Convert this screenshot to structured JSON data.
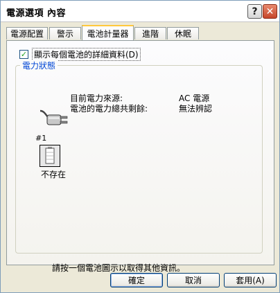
{
  "window": {
    "title": "電源選項 內容",
    "help_label": "?",
    "close_label": "✕"
  },
  "tabs": [
    {
      "label": "電源配置",
      "active": false
    },
    {
      "label": "警示",
      "active": false
    },
    {
      "label": "電池計量器",
      "active": true
    },
    {
      "label": "進階",
      "active": false
    },
    {
      "label": "休眠",
      "active": false
    }
  ],
  "options": {
    "show_details_label": "顯示每個電池的詳細資料(D)",
    "show_details_checked": true
  },
  "power_status": {
    "group_title": "電力狀態",
    "source_label": "目前電力來源:",
    "source_value": "AC 電源",
    "remaining_label": "電池的電力總共剩餘:",
    "remaining_value": "無法辨認"
  },
  "battery": {
    "number": "#1",
    "status": "不存在"
  },
  "hint": "請按一個電池圖示以取得其他資訊。",
  "buttons": {
    "ok": "確定",
    "cancel": "取消",
    "apply": "套用(A)"
  },
  "colors": {
    "accent_tab": "#ffc83c",
    "group_title": "#0046d5",
    "check": "#21a121"
  }
}
